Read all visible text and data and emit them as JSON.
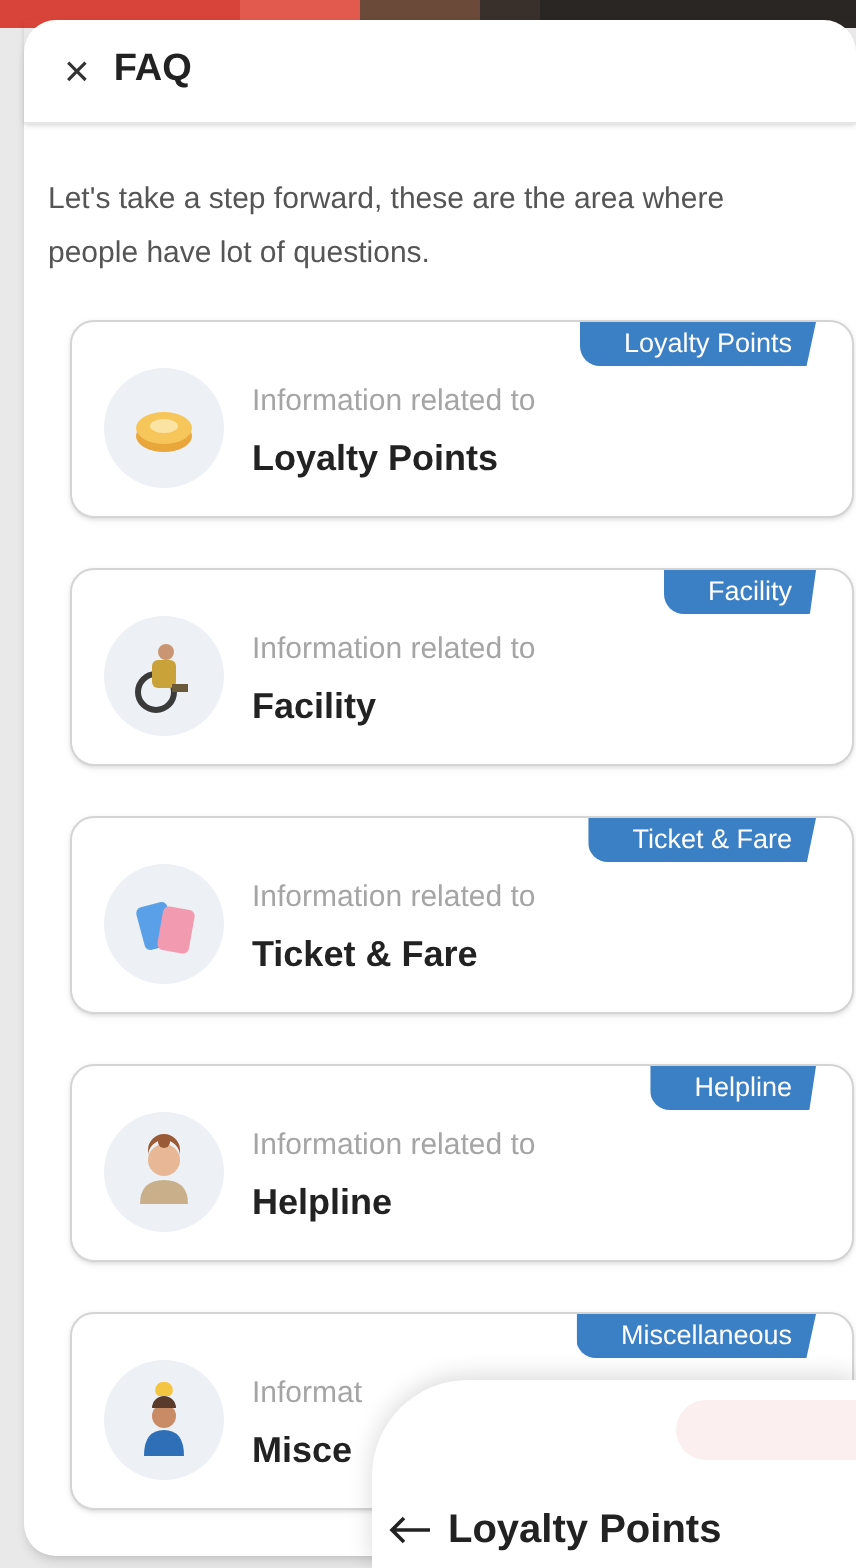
{
  "header": {
    "close_glyph": "×",
    "title": "FAQ"
  },
  "intro": "Let's take a step forward, these are the area where people have lot of questions.",
  "categories": [
    {
      "tag": "Loyalty Points",
      "subtitle": "Information related to",
      "title": "Loyalty Points",
      "kind": "coin"
    },
    {
      "tag": "Facility",
      "subtitle": "Information related to",
      "title": "Facility",
      "kind": "wheelchair"
    },
    {
      "tag": "Ticket & Fare",
      "subtitle": "Information related to",
      "title": "Ticket & Fare",
      "kind": "ticket"
    },
    {
      "tag": "Helpline",
      "subtitle": "Information related to",
      "title": "Helpline",
      "kind": "agent"
    },
    {
      "tag": "Miscellaneous",
      "subtitle": "Informat",
      "title": "Misce",
      "kind": "idea"
    }
  ],
  "next_sheet": {
    "title": "Loyalty Points"
  }
}
